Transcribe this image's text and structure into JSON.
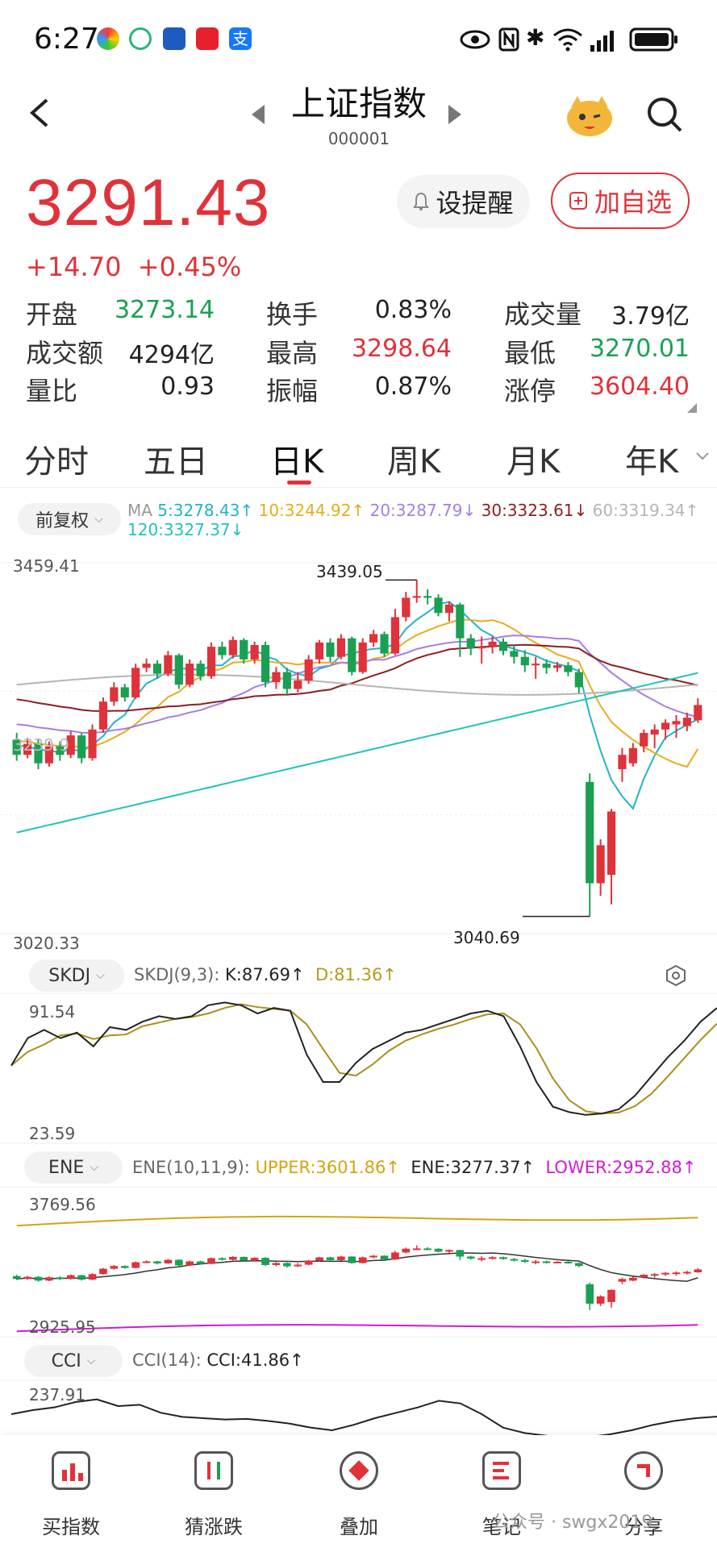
{
  "status": {
    "time": "6:27"
  },
  "header": {
    "title": "上证指数",
    "code": "000001"
  },
  "quote": {
    "price": "3291.43",
    "change": "+14.70",
    "change_pct": "+0.45%",
    "alert_btn": "设提醒",
    "add_btn": "加自选"
  },
  "stats": [
    {
      "label": "开盘",
      "value": "3273.14",
      "color": "#1aa052"
    },
    {
      "label": "换手",
      "value": "0.83%",
      "color": "#222222"
    },
    {
      "label": "成交量",
      "value": "3.79亿",
      "color": "#222222"
    },
    {
      "label": "成交额",
      "value": "4294亿",
      "color": "#222222"
    },
    {
      "label": "最高",
      "value": "3298.64",
      "color": "#e0323a"
    },
    {
      "label": "最低",
      "value": "3270.01",
      "color": "#1aa052"
    },
    {
      "label": "量比",
      "value": "0.93",
      "color": "#222222"
    },
    {
      "label": "振幅",
      "value": "0.87%",
      "color": "#222222"
    },
    {
      "label": "涨停",
      "value": "3604.40",
      "color": "#e0323a"
    }
  ],
  "tabs": [
    "分时",
    "五日",
    "日K",
    "周K",
    "月K",
    "年K"
  ],
  "active_tab": "日K",
  "adjust": "前复权",
  "ma": {
    "prefix": "MA",
    "ma5": "5:3278.43↑",
    "ma10": "10:3244.92↑",
    "ma20": "20:3287.79↓",
    "ma30": "30:3323.61↓",
    "ma60": "60:3319.34↑",
    "ma120": "120:3327.37↓"
  },
  "main_chart": {
    "y_top_label": "3459.41",
    "y_bottom_label": "3020.33",
    "high_marker": "3439.05",
    "low_marker": "3040.69",
    "partial_label": "3239.9"
  },
  "skdj": {
    "name": "SKDJ",
    "params": "SKDJ(9,3):",
    "k": "K:87.69↑",
    "d": "D:81.36↑",
    "top": "91.54",
    "bottom": "23.59"
  },
  "ene": {
    "name": "ENE",
    "params": "ENE(10,11,9):",
    "upper": "UPPER:3601.86↑",
    "ene": "ENE:3277.37↑",
    "lower": "LOWER:2952.88↑",
    "top": "3769.56",
    "bottom": "2925.95"
  },
  "cci": {
    "name": "CCI",
    "params": "CCI(14):",
    "value": "CCI:41.86↑",
    "top": "237.91"
  },
  "bottom_nav": [
    "买指数",
    "猜涨跌",
    "叠加",
    "笔记",
    "分享"
  ],
  "watermark": "公众号 · swgx2019",
  "colors": {
    "up": "#e0323a",
    "down": "#1aa052",
    "ma5": "#1fb5c9",
    "ma10": "#e6ad1e",
    "ma20": "#a77ee3",
    "ma30": "#8b1f1f",
    "ma60": "#b5b5b5",
    "ma120": "#1fc4b8"
  },
  "chart_data": {
    "type": "line",
    "ylim": [
      3020.33,
      3459.41
    ],
    "candles": [
      {
        "o": 3250,
        "c": 3232,
        "h": 3258,
        "l": 3225
      },
      {
        "o": 3232,
        "c": 3245,
        "h": 3252,
        "l": 3228
      },
      {
        "o": 3245,
        "c": 3222,
        "h": 3250,
        "l": 3215
      },
      {
        "o": 3222,
        "c": 3242,
        "h": 3248,
        "l": 3218
      },
      {
        "o": 3242,
        "c": 3232,
        "h": 3248,
        "l": 3225
      },
      {
        "o": 3232,
        "c": 3255,
        "h": 3260,
        "l": 3228
      },
      {
        "o": 3255,
        "c": 3228,
        "h": 3258,
        "l": 3222
      },
      {
        "o": 3228,
        "c": 3262,
        "h": 3268,
        "l": 3225
      },
      {
        "o": 3262,
        "c": 3295,
        "h": 3300,
        "l": 3258
      },
      {
        "o": 3295,
        "c": 3312,
        "h": 3318,
        "l": 3290
      },
      {
        "o": 3312,
        "c": 3300,
        "h": 3316,
        "l": 3295
      },
      {
        "o": 3300,
        "c": 3335,
        "h": 3340,
        "l": 3298
      },
      {
        "o": 3335,
        "c": 3340,
        "h": 3346,
        "l": 3330
      },
      {
        "o": 3340,
        "c": 3328,
        "h": 3344,
        "l": 3322
      },
      {
        "o": 3328,
        "c": 3350,
        "h": 3355,
        "l": 3325
      },
      {
        "o": 3350,
        "c": 3315,
        "h": 3352,
        "l": 3310
      },
      {
        "o": 3315,
        "c": 3340,
        "h": 3345,
        "l": 3312
      },
      {
        "o": 3340,
        "c": 3325,
        "h": 3344,
        "l": 3320
      },
      {
        "o": 3325,
        "c": 3360,
        "h": 3365,
        "l": 3322
      },
      {
        "o": 3360,
        "c": 3350,
        "h": 3366,
        "l": 3345
      },
      {
        "o": 3350,
        "c": 3368,
        "h": 3372,
        "l": 3346
      },
      {
        "o": 3368,
        "c": 3345,
        "h": 3370,
        "l": 3340
      },
      {
        "o": 3345,
        "c": 3362,
        "h": 3366,
        "l": 3340
      },
      {
        "o": 3362,
        "c": 3318,
        "h": 3366,
        "l": 3312
      },
      {
        "o": 3318,
        "c": 3330,
        "h": 3336,
        "l": 3310
      },
      {
        "o": 3330,
        "c": 3310,
        "h": 3335,
        "l": 3302
      },
      {
        "o": 3310,
        "c": 3320,
        "h": 3330,
        "l": 3306
      },
      {
        "o": 3320,
        "c": 3345,
        "h": 3350,
        "l": 3316
      },
      {
        "o": 3345,
        "c": 3365,
        "h": 3368,
        "l": 3340
      },
      {
        "o": 3365,
        "c": 3348,
        "h": 3370,
        "l": 3342
      },
      {
        "o": 3348,
        "c": 3370,
        "h": 3375,
        "l": 3345
      },
      {
        "o": 3370,
        "c": 3330,
        "h": 3372,
        "l": 3326
      },
      {
        "o": 3330,
        "c": 3365,
        "h": 3370,
        "l": 3328
      },
      {
        "o": 3365,
        "c": 3375,
        "h": 3380,
        "l": 3360
      },
      {
        "o": 3375,
        "c": 3352,
        "h": 3378,
        "l": 3348
      },
      {
        "o": 3352,
        "c": 3395,
        "h": 3405,
        "l": 3350
      },
      {
        "o": 3395,
        "c": 3418,
        "h": 3425,
        "l": 3390
      },
      {
        "o": 3418,
        "c": 3420,
        "h": 3439,
        "l": 3412
      },
      {
        "o": 3420,
        "c": 3418,
        "h": 3428,
        "l": 3410
      },
      {
        "o": 3418,
        "c": 3400,
        "h": 3422,
        "l": 3396
      },
      {
        "o": 3400,
        "c": 3410,
        "h": 3414,
        "l": 3390
      },
      {
        "o": 3410,
        "c": 3370,
        "h": 3412,
        "l": 3348
      },
      {
        "o": 3370,
        "c": 3358,
        "h": 3375,
        "l": 3350
      },
      {
        "o": 3358,
        "c": 3360,
        "h": 3372,
        "l": 3340
      },
      {
        "o": 3360,
        "c": 3366,
        "h": 3372,
        "l": 3352
      },
      {
        "o": 3366,
        "c": 3355,
        "h": 3370,
        "l": 3350
      },
      {
        "o": 3355,
        "c": 3348,
        "h": 3362,
        "l": 3340
      },
      {
        "o": 3348,
        "c": 3338,
        "h": 3356,
        "l": 3330
      },
      {
        "o": 3338,
        "c": 3340,
        "h": 3348,
        "l": 3322
      },
      {
        "o": 3340,
        "c": 3335,
        "h": 3345,
        "l": 3328
      },
      {
        "o": 3335,
        "c": 3338,
        "h": 3342,
        "l": 3330
      },
      {
        "o": 3338,
        "c": 3330,
        "h": 3342,
        "l": 3325
      },
      {
        "o": 3330,
        "c": 3312,
        "h": 3334,
        "l": 3305
      },
      {
        "o": 3200,
        "c": 3080,
        "h": 3210,
        "l": 3040.69
      },
      {
        "o": 3080,
        "c": 3125,
        "h": 3132,
        "l": 3065
      },
      {
        "o": 3090,
        "c": 3165,
        "h": 3168,
        "l": 3055
      },
      {
        "o": 3215,
        "c": 3232,
        "h": 3240,
        "l": 3200
      },
      {
        "o": 3222,
        "c": 3240,
        "h": 3246,
        "l": 3218
      },
      {
        "o": 3242,
        "c": 3258,
        "h": 3262,
        "l": 3235
      },
      {
        "o": 3256,
        "c": 3262,
        "h": 3268,
        "l": 3240
      },
      {
        "o": 3262,
        "c": 3270,
        "h": 3274,
        "l": 3250
      },
      {
        "o": 3268,
        "c": 3272,
        "h": 3279,
        "l": 3252
      },
      {
        "o": 3266,
        "c": 3276,
        "h": 3282,
        "l": 3260
      },
      {
        "o": 3273,
        "c": 3291,
        "h": 3299,
        "l": 3270
      }
    ]
  }
}
